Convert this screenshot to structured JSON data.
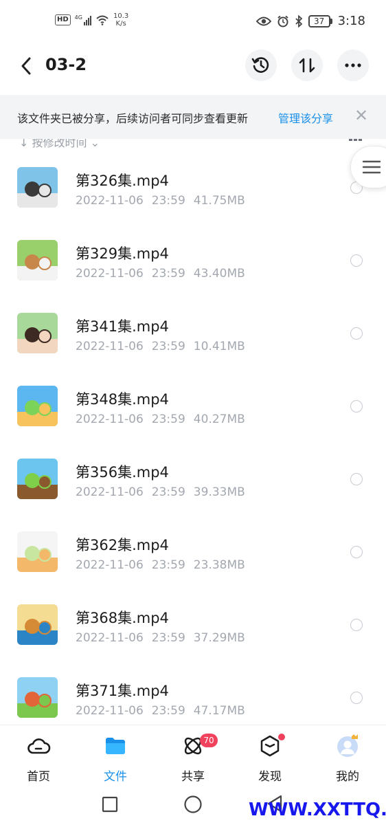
{
  "status_bar": {
    "hd": "HD",
    "network": "4G",
    "speed_value": "10.3",
    "speed_unit": "K/s",
    "battery": "37",
    "time": "3:18"
  },
  "header": {
    "title": "03-2"
  },
  "share_banner": {
    "text": "该文件夹已被分享，后续访问者可同步查看更新",
    "link": "管理该分享"
  },
  "sort": {
    "label": "按修改时间"
  },
  "files": [
    {
      "name": "第326集.mp4",
      "date": "2022-11-06",
      "time": "23:59",
      "size": "41.75MB",
      "thumb_colors": [
        "#7fc4e8",
        "#3a3a3a",
        "#e7e7e7"
      ]
    },
    {
      "name": "第329集.mp4",
      "date": "2022-11-06",
      "time": "23:59",
      "size": "43.40MB",
      "thumb_colors": [
        "#9ad06c",
        "#c8874a",
        "#f3f3f3"
      ]
    },
    {
      "name": "第341集.mp4",
      "date": "2022-11-06",
      "time": "23:59",
      "size": "10.41MB",
      "thumb_colors": [
        "#a8d89a",
        "#3d2a22",
        "#f2d6c0"
      ]
    },
    {
      "name": "第348集.mp4",
      "date": "2022-11-06",
      "time": "23:59",
      "size": "40.27MB",
      "thumb_colors": [
        "#5cb7f0",
        "#7bd35a",
        "#f6c35c"
      ]
    },
    {
      "name": "第356集.mp4",
      "date": "2022-11-06",
      "time": "23:59",
      "size": "39.33MB",
      "thumb_colors": [
        "#6bc5ee",
        "#7fcf4a",
        "#8a5a2e"
      ]
    },
    {
      "name": "第362集.mp4",
      "date": "2022-11-06",
      "time": "23:59",
      "size": "23.38MB",
      "thumb_colors": [
        "#f5f5f5",
        "#c9e6a0",
        "#f4b86a"
      ]
    },
    {
      "name": "第368集.mp4",
      "date": "2022-11-06",
      "time": "23:59",
      "size": "37.29MB",
      "thumb_colors": [
        "#f4dc92",
        "#d58a36",
        "#2a84c6"
      ]
    },
    {
      "name": "第371集.mp4",
      "date": "2022-11-06",
      "time": "23:59",
      "size": "47.17MB",
      "thumb_colors": [
        "#8fd1f2",
        "#e2653a",
        "#7cc84e"
      ]
    }
  ],
  "bottom_nav": {
    "items": [
      {
        "label": "首页",
        "icon": "cloud-home-icon"
      },
      {
        "label": "文件",
        "icon": "folder-icon"
      },
      {
        "label": "共享",
        "icon": "share-atom-icon",
        "badge": "70"
      },
      {
        "label": "发现",
        "icon": "discover-cube-icon"
      },
      {
        "label": "我的",
        "icon": "avatar-icon"
      }
    ],
    "active_index": 1
  },
  "watermark": "WWW.XXTTQ.COM",
  "colors": {
    "accent": "#1a90e8",
    "badge": "#f0425c",
    "meta_text": "#a3a8b0",
    "banner_bg": "#f3f4f6"
  }
}
